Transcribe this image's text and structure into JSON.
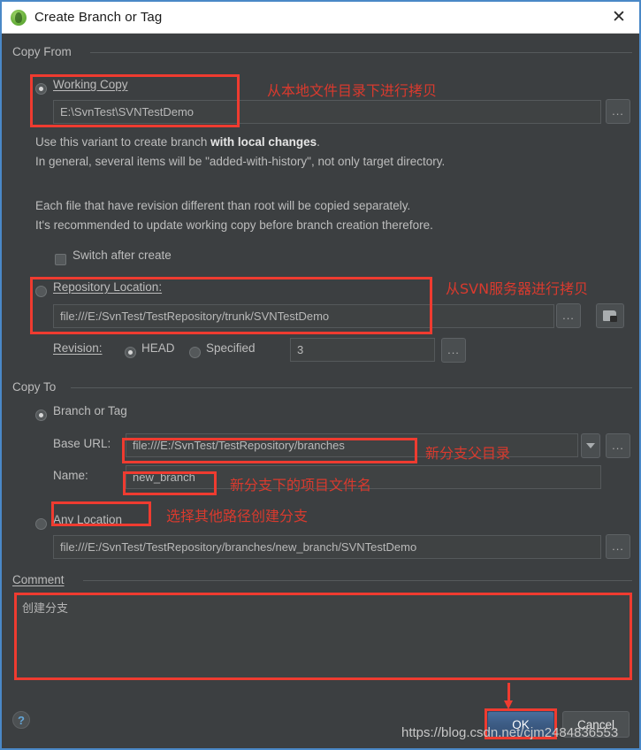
{
  "window": {
    "title": "Create Branch or Tag",
    "icon": "svn-green-icon",
    "close_label": "✕"
  },
  "copy_from": {
    "group_label": "Copy From",
    "working_copy": {
      "radio_label": "Working Copy",
      "selected": true,
      "path_value": "E:\\SvnTest\\SVNTestDemo",
      "browse_label": "..."
    },
    "description_lines": [
      {
        "prefix": "Use this variant to create branch ",
        "bold": "with local changes",
        "suffix": "."
      },
      {
        "prefix": "In general, several items will be \"added-with-history\", not only target directory.",
        "bold": "",
        "suffix": ""
      },
      {
        "prefix": "Each file that have revision different than root will be copied separately.",
        "bold": "",
        "suffix": ""
      },
      {
        "prefix": "It's recommended to update working copy before branch creation therefore.",
        "bold": "",
        "suffix": ""
      }
    ],
    "switch_after_create": {
      "label": "Switch after create",
      "checked": false
    },
    "repository_location": {
      "radio_label": "Repository Location:",
      "selected": false,
      "url_value": "file:///E:/SvnTest/TestRepository/trunk/SVNTestDemo",
      "browse_label": "...",
      "folder_button": "folder-icon"
    },
    "revision": {
      "label": "Revision:",
      "head_label": "HEAD",
      "head_selected": true,
      "specified_label": "Specified",
      "specified_selected": false,
      "specified_value": "3",
      "browse_label": "..."
    }
  },
  "copy_to": {
    "group_label": "Copy To",
    "branch_or_tag": {
      "radio_label": "Branch or Tag",
      "selected": true
    },
    "base_url": {
      "label": "Base URL:",
      "value": "file:///E:/SvnTest/TestRepository/branches",
      "dropdown": "chevron-down-icon",
      "browse_label": "..."
    },
    "name": {
      "label": "Name:",
      "value": "new_branch"
    },
    "any_location": {
      "radio_label": "Any Location",
      "selected": false,
      "value": "file:///E:/SvnTest/TestRepository/branches/new_branch/SVNTestDemo",
      "browse_label": "..."
    }
  },
  "comment": {
    "group_label": "Comment",
    "value": "创建分支"
  },
  "footer": {
    "help_label": "?",
    "ok_label": "OK",
    "cancel_label": "Cancel"
  },
  "annotations": [
    {
      "id": "ann-working-copy",
      "text": "从本地文件目录下进行拷贝"
    },
    {
      "id": "ann-repo-location",
      "text": "从SVN服务器进行拷贝"
    },
    {
      "id": "ann-base-url",
      "text": "新分支父目录"
    },
    {
      "id": "ann-name",
      "text": "新分支下的项目文件名"
    },
    {
      "id": "ann-any-location",
      "text": "选择其他路径创建分支"
    }
  ],
  "watermark": {
    "text": "https://blog.csdn.net/cjm2484836553"
  },
  "colors": {
    "accent_red": "#ef3b30",
    "dialog_bg": "#3c3f41",
    "border_blue": "#4a88c7",
    "primary_button": "#3c5b84"
  }
}
